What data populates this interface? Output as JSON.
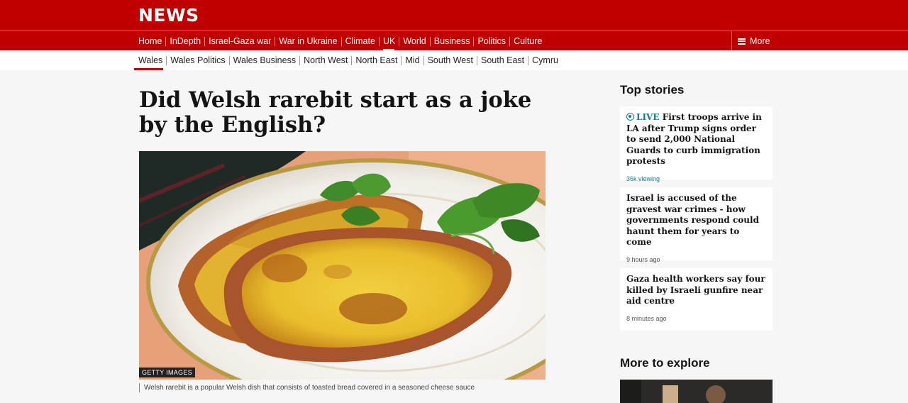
{
  "header": {
    "logo": "NEWS"
  },
  "main_nav": {
    "items": [
      {
        "label": "Home"
      },
      {
        "label": "InDepth"
      },
      {
        "label": "Israel-Gaza war"
      },
      {
        "label": "War in Ukraine"
      },
      {
        "label": "Climate"
      },
      {
        "label": "UK",
        "active": true
      },
      {
        "label": "World"
      },
      {
        "label": "Business"
      },
      {
        "label": "Politics"
      },
      {
        "label": "Culture"
      }
    ],
    "more_label": "More"
  },
  "sub_nav": {
    "items": [
      {
        "label": "Wales",
        "active": true
      },
      {
        "label": "Wales Politics"
      },
      {
        "label": "Wales Business"
      },
      {
        "label": "North West"
      },
      {
        "label": "North East"
      },
      {
        "label": "Mid"
      },
      {
        "label": "South West"
      },
      {
        "label": "South East"
      },
      {
        "label": "Cymru"
      }
    ]
  },
  "article": {
    "headline": "Did Welsh rarebit start as a joke by the English?",
    "image_credit": "GETTY IMAGES",
    "image_caption": "Welsh rarebit is a popular Welsh dish that consists of toasted bread covered in a seasoned cheese sauce"
  },
  "top_stories": {
    "title": "Top stories",
    "items": [
      {
        "live_label": "LIVE",
        "title": "First troops arrive in LA after Trump signs order to send 2,000 National Guards to curb immigration protests",
        "meta": "36k viewing"
      },
      {
        "title": "Israel is accused of the gravest war crimes - how governments respond could haunt them for years to come",
        "meta": "9 hours ago"
      },
      {
        "title": "Gaza health workers say four killed by Israeli gunfire near aid centre",
        "meta": "8 minutes ago"
      }
    ]
  },
  "more_to_explore": {
    "title": "More to explore"
  },
  "colors": {
    "brand_red": "#c00000",
    "live_teal": "#117c8a",
    "background": "#f6f6f6"
  }
}
